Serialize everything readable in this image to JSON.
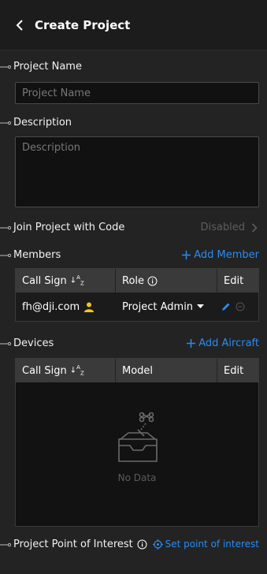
{
  "header": {
    "title": "Create Project"
  },
  "project_name": {
    "label": "Project Name",
    "placeholder": "Project Name"
  },
  "description": {
    "label": "Description",
    "placeholder": "Description"
  },
  "join": {
    "label": "Join Project with Code",
    "status": "Disabled"
  },
  "members": {
    "label": "Members",
    "add_label": "Add Member",
    "columns": [
      "Call Sign",
      "Role",
      "Edit"
    ],
    "rows": [
      {
        "call_sign": "fh@dji.com",
        "role": "Project Admin"
      }
    ]
  },
  "devices": {
    "label": "Devices",
    "add_label": "Add Aircraft",
    "columns": [
      "Call Sign",
      "Model",
      "Edit"
    ],
    "empty_text": "No Data"
  },
  "poi": {
    "label": "Project Point of Interest",
    "action": "Set point of interest"
  },
  "colors": {
    "accent": "#2a8cf2",
    "admin_icon": "#f5c518",
    "background": "#232323"
  },
  "icons": {
    "back": "chevron-left-icon",
    "sort": "sort-icon",
    "info": "info-icon",
    "user": "user-icon",
    "caret": "caret-down-icon",
    "edit": "pencil-icon",
    "remove": "remove-icon",
    "plus": "plus-icon",
    "target": "target-icon",
    "empty": "empty-box-icon"
  }
}
